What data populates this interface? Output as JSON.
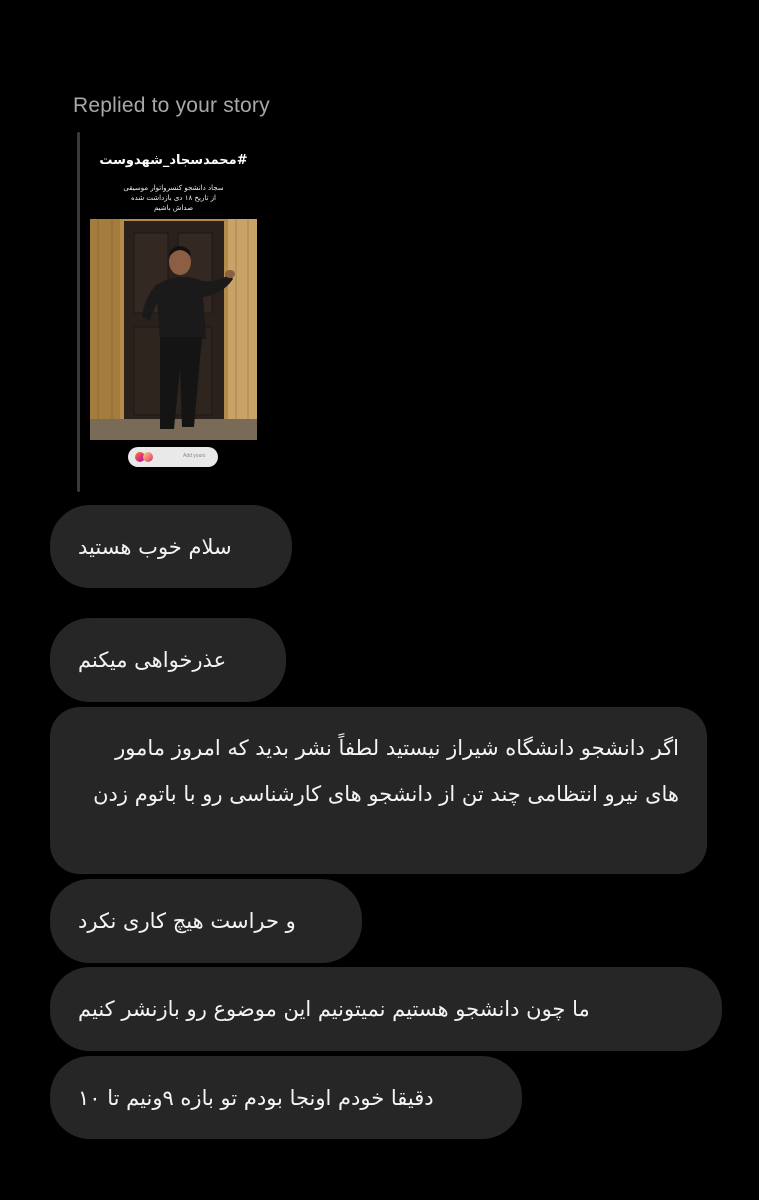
{
  "reply": {
    "header": "Replied to your story"
  },
  "story": {
    "title": "#محمدسجاد_شهدوست",
    "caption_lines": [
      "سجاد دانشجو کنسرواتوار موسیقی",
      "از تاریخ ۱۸ دی بازداشت شده",
      "صداش باشیم"
    ],
    "pill_text": "Add yours",
    "colors": {
      "wall_left": "#b38b4a",
      "wall_right": "#c9a267",
      "door": "#2a211c",
      "clothes": "#1a1a1a"
    }
  },
  "messages": [
    {
      "text": "سلام خوب هستید"
    },
    {
      "text": "عذرخواهی میکنم"
    },
    {
      "text": "اگر دانشجو دانشگاه شیراز نیستید لطفاً نشر بدید که امروز مامور های نیرو انتظامی چند تن از دانشجو های کارشناسی رو با باتوم زدن"
    },
    {
      "text": "و حراست هیچ کاری نکرد"
    },
    {
      "text": "ما چون دانشجو هستیم نمیتونیم این موضوع رو بازنشر کنیم"
    },
    {
      "text": "دقیقا خودم اونجا بودم تو بازه ۹ونیم تا ۱۰"
    }
  ],
  "theme": {
    "background": "#000000",
    "bubble": "#262626",
    "text": "#f4f4f4",
    "muted": "#a8a8a8"
  }
}
